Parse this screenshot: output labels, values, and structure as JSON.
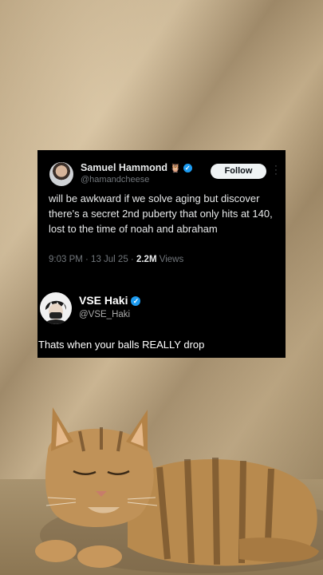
{
  "tweet": {
    "author_name": "Samuel Hammond",
    "author_emoji": "🦉",
    "author_handle": "@hamandcheese",
    "follow_label": "Follow",
    "text": "will be awkward if we solve aging but discover there's a secret 2nd puberty that only hits at 140, lost to the time of noah and abraham",
    "time": "9:03 PM · 13 Jul 25 · ",
    "views_count": "2.2M",
    "views_label": " Views",
    "verified_icon": "verified-badge-icon",
    "more_icon": "more-options-icon"
  },
  "reply": {
    "author_name": "VSE Haki",
    "author_handle": "@VSE_Haki",
    "text": "Thats when your balls REALLY drop",
    "verified_icon": "verified-badge-icon"
  },
  "colors": {
    "card_bg": "#000000",
    "verified": "#1d9bf0",
    "follow_bg": "#eff3f4",
    "muted": "#71767b"
  }
}
